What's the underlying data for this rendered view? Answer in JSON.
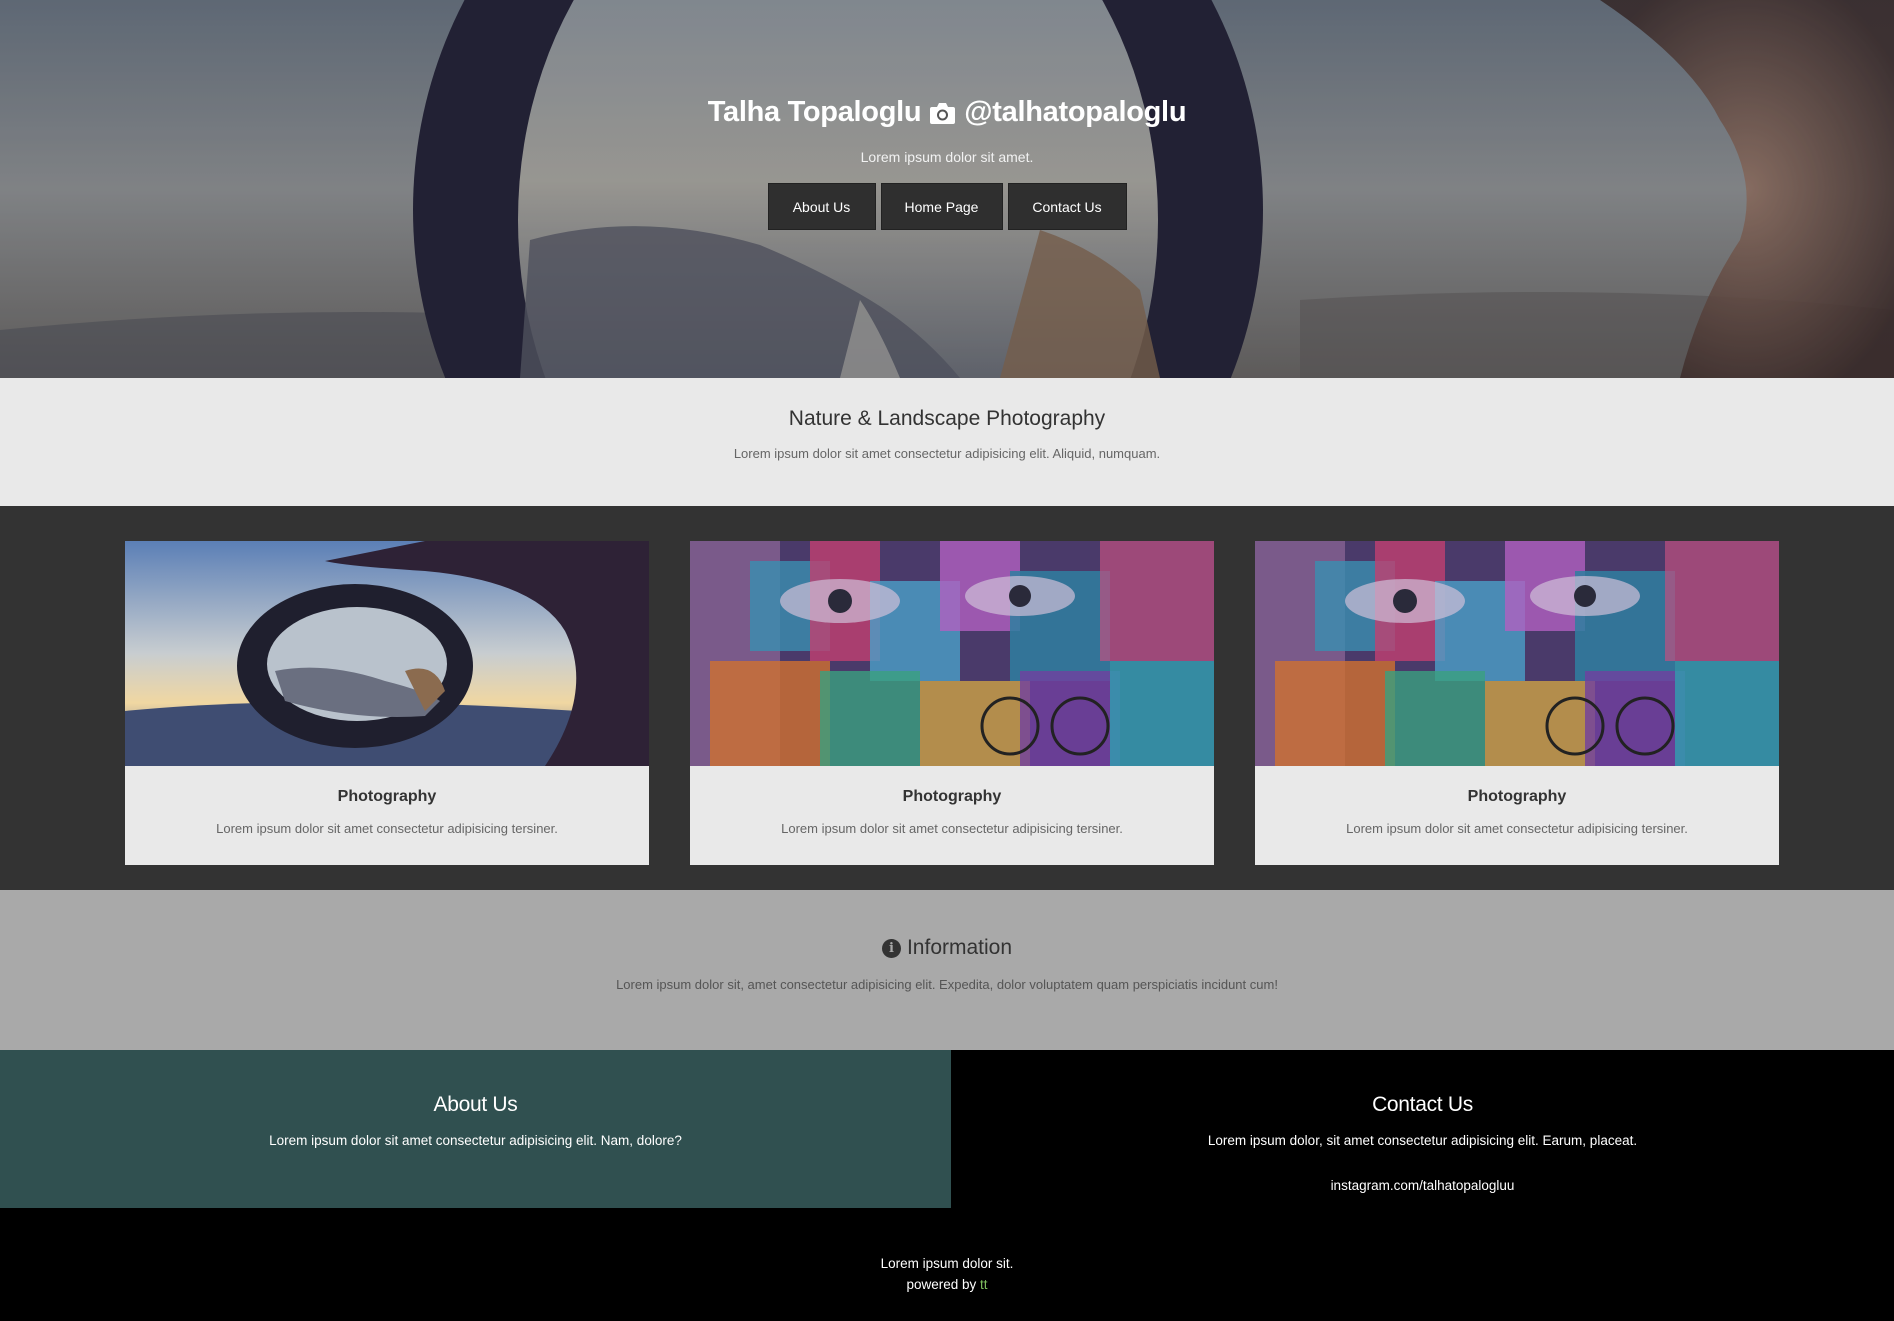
{
  "hero": {
    "name": "Talha Topaloglu",
    "handle": "@talhatopaloglu",
    "subtitle": "Lorem ipsum dolor sit amet.",
    "nav": [
      "About Us",
      "Home Page",
      "Contact Us"
    ],
    "icon": "camera-icon"
  },
  "intro": {
    "title": "Nature & Landscape Photography",
    "text": "Lorem ipsum dolor sit amet consectetur adipisicing elit. Aliquid, numquam."
  },
  "cards": [
    {
      "title": "Photography",
      "text": "Lorem ipsum dolor sit amet consectetur adipisicing tersiner."
    },
    {
      "title": "Photography",
      "text": "Lorem ipsum dolor sit amet consectetur adipisicing tersiner."
    },
    {
      "title": "Photography",
      "text": "Lorem ipsum dolor sit amet consectetur adipisicing tersiner."
    }
  ],
  "info": {
    "title": "Information",
    "icon": "info-circle-icon",
    "icon_glyph": "i",
    "text": "Lorem ipsum dolor sit, amet consectetur adipisicing elit. Expedita, dolor voluptatem quam perspiciatis incidunt cum!"
  },
  "about": {
    "title": "About Us",
    "text": "Lorem ipsum dolor sit amet consectetur adipisicing elit. Nam, dolore?"
  },
  "contact": {
    "title": "Contact Us",
    "text": "Lorem ipsum dolor, sit amet consectetur adipisicing elit. Earum, placeat.",
    "link": "instagram.com/talhatopalogluu"
  },
  "footer": {
    "line1": "Lorem ipsum dolor sit.",
    "powered": "powered by",
    "brand": "tt"
  },
  "colors": {
    "intro_bg": "#e9e9e9",
    "cards_bg": "#333333",
    "info_bg": "#a9a9a9",
    "about_bg": "#305050",
    "contact_bg": "#000000",
    "brand_link": "#7fbf5f"
  }
}
